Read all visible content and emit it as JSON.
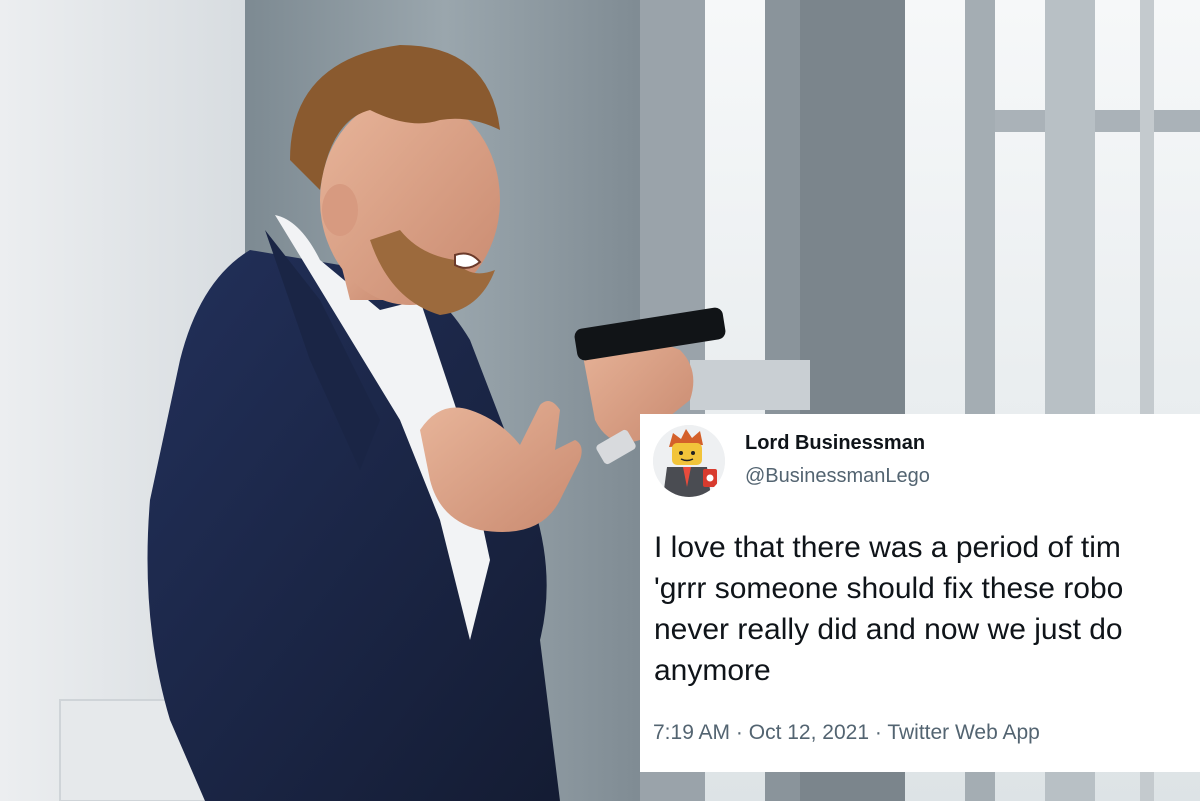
{
  "tweet": {
    "display_name": "Lord Businessman",
    "handle": "@BusinessmanLego",
    "text_lines": [
      "I love that there was a period of tim",
      "'grrr someone should fix these robo",
      "never really did and now we just do",
      "anymore"
    ],
    "time": "7:19 AM",
    "date": "Oct 12, 2021",
    "source": "Twitter Web App",
    "separator": "·"
  },
  "photo": {
    "subject": "man in navy suit shouting at a phone held in his hand, standing by a window"
  },
  "colors": {
    "text_primary": "#0f1419",
    "text_secondary": "#536471",
    "suit": "#1f2c4d",
    "window_frame": "#8c969e"
  }
}
